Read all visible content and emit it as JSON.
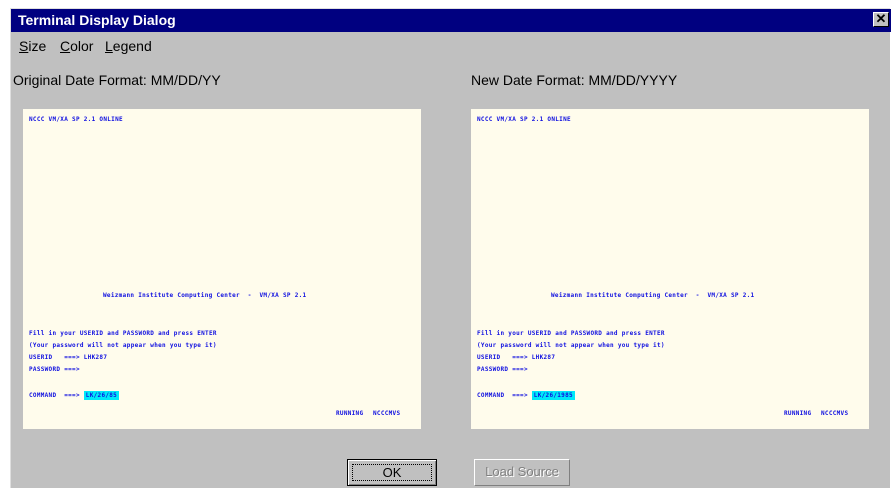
{
  "window": {
    "title": "Terminal Display Dialog",
    "close_glyph": "✕"
  },
  "menu": {
    "items": [
      {
        "label": "Size",
        "accel": "S",
        "rest": "ize"
      },
      {
        "label": "Color",
        "accel": "C",
        "rest": "olor"
      },
      {
        "label": "Legend",
        "accel": "L",
        "rest": "egend"
      }
    ]
  },
  "panels": {
    "original": {
      "label": "Original Date Format: MM/DD/YY",
      "lines": {
        "header": "NCCC VM/XA SP 2.1 ONLINE",
        "center": "Weizmann Institute Computing Center  -  VM/XA SP 2.1",
        "fill": "Fill in your USERID and PASSWORD and press ENTER",
        "note": "(Your password will not appear when you type it)",
        "userid": "USERID   ===> LHK287",
        "password": "PASSWORD ===>",
        "command_prefix": "COMMAND  ===>",
        "command_value": "LK/26/85",
        "status_running": "RUNNING",
        "status_host": "NCCCMVS"
      }
    },
    "new": {
      "label": "New Date Format: MM/DD/YYYY",
      "lines": {
        "header": "NCCC VM/XA SP 2.1 ONLINE",
        "center": "Weizmann Institute Computing Center  -  VM/XA SP 2.1",
        "fill": "Fill in your USERID and PASSWORD and press ENTER",
        "note": "(Your password will not appear when you type it)",
        "userid": "USERID   ===> LHK287",
        "password": "PASSWORD ===>",
        "command_prefix": "COMMAND  ===>",
        "command_value": "LK/26/1985",
        "status_running": "RUNNING",
        "status_host": "NCCCMVS"
      }
    }
  },
  "buttons": {
    "ok": "OK",
    "load_source": "Load Source"
  },
  "colors": {
    "titlebar": "#000080",
    "dialog_bg": "#c0c0c0",
    "terminal_bg": "#fffcec",
    "terminal_text": "#1010e0",
    "highlight": "#00e8f8"
  }
}
